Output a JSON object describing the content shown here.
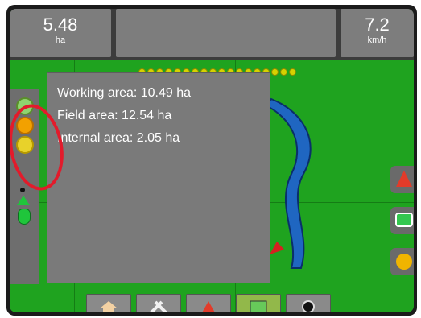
{
  "status": {
    "speed_left": {
      "value": "5.48",
      "unit": "ha"
    },
    "speed_right": {
      "value": "7.2",
      "unit": "km/h"
    }
  },
  "info": {
    "working_area": "Working area: 10.49 ha",
    "field_area": "Field area: 12.54 ha",
    "internal_area": "Internal area: 2.05 ha"
  },
  "colors": {
    "field": "#1fa31f",
    "panel": "#7a7a7a",
    "topbar": "#7d7d7d",
    "accent": "#d62020",
    "path": "#1f66c1"
  },
  "icons": {
    "right_buttons": [
      "arrow-up-icon",
      "screen-icon",
      "hand-icon"
    ],
    "bottom_tabs": [
      "home-icon",
      "tools-icon",
      "alert-icon",
      "map-icon",
      "camera-icon"
    ]
  }
}
